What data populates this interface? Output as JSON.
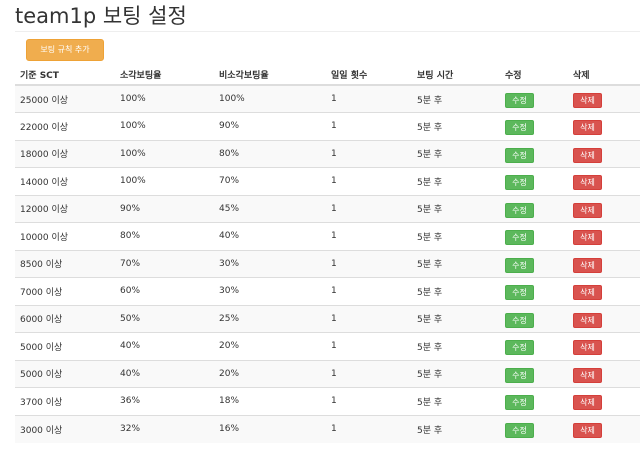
{
  "page": {
    "title": "team1p 보팅 설정"
  },
  "toolbar": {
    "add_label": "보팅 규칙 추가"
  },
  "colors": {
    "add_button": "#f0ad4e",
    "edit_button": "#5cb85c",
    "delete_button": "#d9534f"
  },
  "table": {
    "headers": [
      "기준 SCT",
      "소각보팅율",
      "비소각보팅율",
      "일일 횟수",
      "보팅 시간",
      "수정",
      "삭제"
    ],
    "edit_label": "수정",
    "delete_label": "삭제",
    "rows": [
      [
        "25000 이상",
        "100%",
        "100%",
        "1",
        "5분 후"
      ],
      [
        "22000 이상",
        "100%",
        "90%",
        "1",
        "5분 후"
      ],
      [
        "18000 이상",
        "100%",
        "80%",
        "1",
        "5분 후"
      ],
      [
        "14000 이상",
        "100%",
        "70%",
        "1",
        "5분 후"
      ],
      [
        "12000 이상",
        "90%",
        "45%",
        "1",
        "5분 후"
      ],
      [
        "10000 이상",
        "80%",
        "40%",
        "1",
        "5분 후"
      ],
      [
        "8500 이상",
        "70%",
        "30%",
        "1",
        "5분 후"
      ],
      [
        "7000 이상",
        "60%",
        "30%",
        "1",
        "5분 후"
      ],
      [
        "6000 이상",
        "50%",
        "25%",
        "1",
        "5분 후"
      ],
      [
        "5000 이상",
        "40%",
        "20%",
        "1",
        "5분 후"
      ],
      [
        "5000 이상",
        "40%",
        "20%",
        "1",
        "5분 후"
      ],
      [
        "3700 이상",
        "36%",
        "18%",
        "1",
        "5분 후"
      ],
      [
        "3000 이상",
        "32%",
        "16%",
        "1",
        "5분 후"
      ]
    ]
  }
}
